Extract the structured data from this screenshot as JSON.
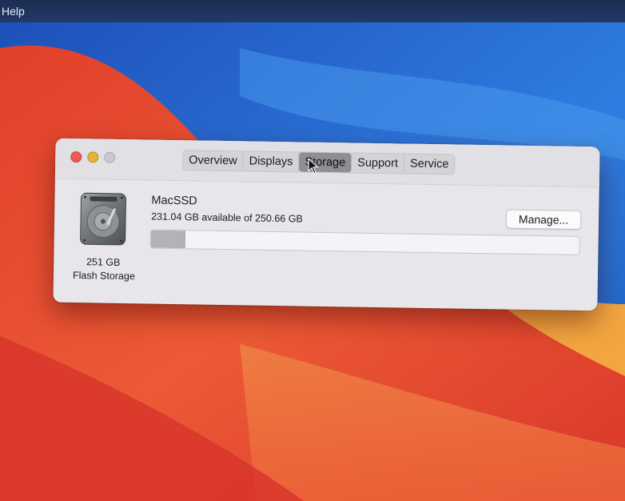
{
  "menubar": {
    "help_label": "Help"
  },
  "window": {
    "tabs": [
      {
        "label": "Overview",
        "selected": false
      },
      {
        "label": "Displays",
        "selected": false
      },
      {
        "label": "Storage",
        "selected": true
      },
      {
        "label": "Support",
        "selected": false
      },
      {
        "label": "Service",
        "selected": false
      }
    ],
    "disk": {
      "size_label": "251 GB",
      "type_label": "Flash Storage",
      "icon": "internal-drive-icon"
    },
    "volume": {
      "name": "MacSSD",
      "usage_text": "231.04 GB available of 250.66 GB",
      "used_fraction": 0.078
    },
    "manage_label": "Manage..."
  },
  "colors": {
    "close": "#ec5b54",
    "minimize": "#e6b03a",
    "selected_tab": "#8f8e94",
    "storage_used": "#b3b2b7"
  }
}
